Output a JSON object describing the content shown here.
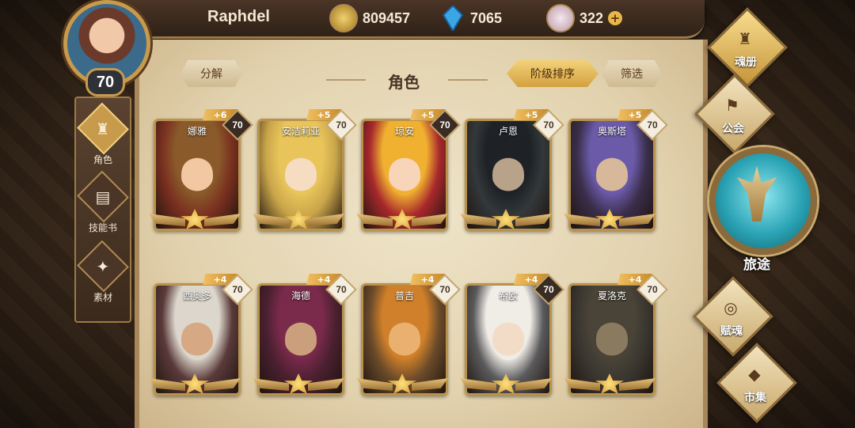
{
  "player": {
    "name": "Raphdel",
    "level": "70"
  },
  "resources": {
    "gold": "809457",
    "crystal": "7065",
    "gem": "322"
  },
  "panel": {
    "decompose_label": "分解",
    "title": "角色",
    "sort_label": "阶级排序",
    "filter_label": "筛选"
  },
  "left_tabs": [
    {
      "label": "角色",
      "icon": "helmet-icon",
      "active": true
    },
    {
      "label": "技能书",
      "icon": "skill-book-icon",
      "active": false
    },
    {
      "label": "素材",
      "icon": "material-icon",
      "active": false
    }
  ],
  "heroes": [
    {
      "name": "娜雅",
      "plus": "+6",
      "level": "70",
      "badge": "dark",
      "hair": "#8a5a2a",
      "bg": "#7a3020",
      "skin": "#f2c8a2"
    },
    {
      "name": "安洁莉亚",
      "plus": "+5",
      "level": "70",
      "badge": "light",
      "hair": "#e8c45a",
      "bg": "#c9a54a",
      "skin": "#f6dcc0"
    },
    {
      "name": "琼安",
      "plus": "+5",
      "level": "70",
      "badge": "dark",
      "hair": "#f0b030",
      "bg": "#a8282c",
      "skin": "#f8d4b8"
    },
    {
      "name": "卢恩",
      "plus": "+5",
      "level": "70",
      "badge": "light",
      "hair": "#1e2226",
      "bg": "#33383a",
      "skin": "#b9a28a"
    },
    {
      "name": "奥斯塔",
      "plus": "+5",
      "level": "70",
      "badge": "light",
      "hair": "#6a5aa8",
      "bg": "#3a2e4a",
      "skin": "#d8b89a"
    },
    {
      "name": "西奥多",
      "plus": "+4",
      "level": "70",
      "badge": "light",
      "hair": "#dcd6cc",
      "bg": "#5a3a3a",
      "skin": "#d6a884"
    },
    {
      "name": "海德",
      "plus": "+4",
      "level": "70",
      "badge": "light",
      "hair": "#7a2a4a",
      "bg": "#4a2030",
      "skin": "#caa07c"
    },
    {
      "name": "普吉",
      "plus": "+4",
      "level": "70",
      "badge": "light",
      "hair": "#d0802a",
      "bg": "#6a4a2a",
      "skin": "#e9b070"
    },
    {
      "name": "希欧",
      "plus": "+4",
      "level": "70",
      "badge": "dark",
      "hair": "#f0ece6",
      "bg": "#5a5a5c",
      "skin": "#f2dcc8"
    },
    {
      "name": "夏洛克",
      "plus": "+4",
      "level": "70",
      "badge": "light",
      "hair": "#4a4438",
      "bg": "#3a3630",
      "skin": "#8a7a60"
    }
  ],
  "right_menu": [
    {
      "label": "魂册",
      "icon": "soul-book-icon",
      "active": true
    },
    {
      "label": "公会",
      "icon": "guild-icon",
      "active": false
    },
    {
      "label": "赋魂",
      "icon": "soul-infuse-icon",
      "active": false
    },
    {
      "label": "市集",
      "icon": "market-icon",
      "active": false
    }
  ],
  "journey_label": "旅途",
  "colors": {
    "accent_gold": "#d3a13f",
    "parchment": "#e2d2ae",
    "frame": "#b9924e"
  }
}
